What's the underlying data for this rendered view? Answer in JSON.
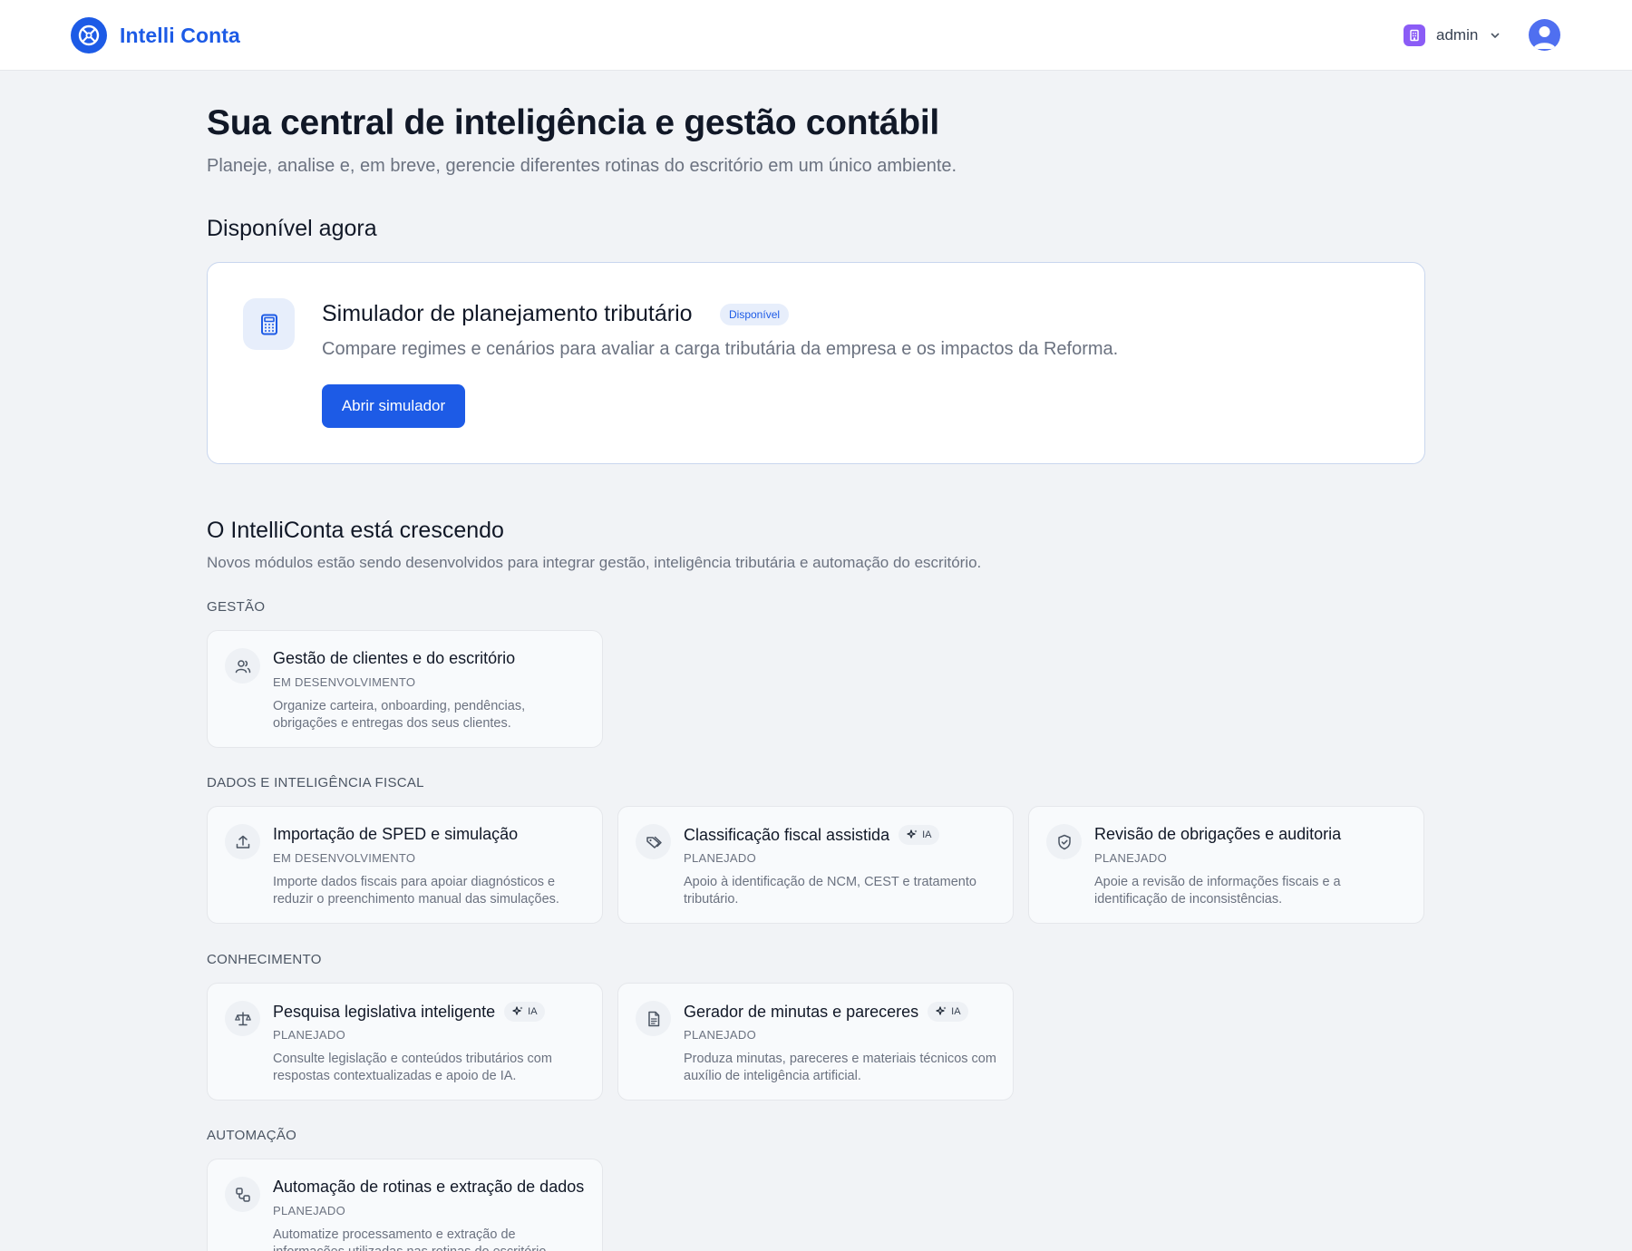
{
  "header": {
    "brand": "Intelli Conta",
    "user": "admin",
    "tenant_icon": "building-icon",
    "avatar_icon": "user-avatar-icon"
  },
  "hero": {
    "title": "Sua central de inteligência e gestão contábil",
    "subtitle": "Planeje, analise e, em breve, gerencie diferentes rotinas do escritório em um único ambiente."
  },
  "available": {
    "section_title": "Disponível agora",
    "card": {
      "icon": "calculator-icon",
      "title": "Simulador de planejamento tributário",
      "badge": "Disponível",
      "description": "Compare regimes e cenários para avaliar a carga tributária da empresa e os impactos da Reforma.",
      "button": "Abrir simulador"
    }
  },
  "growing": {
    "title": "O IntelliConta está crescendo",
    "subtitle": "Novos módulos estão sendo desenvolvidos para integrar gestão, inteligência tributária e automação do escritório."
  },
  "categories": [
    {
      "label": "GESTÃO",
      "modules": [
        {
          "icon": "users-icon",
          "title": "Gestão de clientes e do escritório",
          "status": "EM DESENVOLVIMENTO",
          "description": "Organize carteira, onboarding, pendências, obrigações e entregas dos seus clientes.",
          "ia": ""
        }
      ]
    },
    {
      "label": "DADOS E INTELIGÊNCIA FISCAL",
      "modules": [
        {
          "icon": "upload-icon",
          "title": "Importação de SPED e simulação",
          "status": "EM DESENVOLVIMENTO",
          "description": "Importe dados fiscais para apoiar diagnósticos e reduzir o preenchimento manual das simulações.",
          "ia": ""
        },
        {
          "icon": "tags-icon",
          "title": "Classificação fiscal assistida",
          "status": "PLANEJADO",
          "description": "Apoio à identificação de NCM, CEST e tratamento tributário.",
          "ia": "IA"
        },
        {
          "icon": "shield-check-icon",
          "title": "Revisão de obrigações e auditoria",
          "status": "PLANEJADO",
          "description": "Apoie a revisão de informações fiscais e a identificação de inconsistências.",
          "ia": ""
        }
      ]
    },
    {
      "label": "CONHECIMENTO",
      "modules": [
        {
          "icon": "scale-icon",
          "title": "Pesquisa legislativa inteligente",
          "status": "PLANEJADO",
          "description": "Consulte legislação e conteúdos tributários com respostas contextualizadas e apoio de IA.",
          "ia": "IA"
        },
        {
          "icon": "document-icon",
          "title": "Gerador de minutas e pareceres",
          "status": "PLANEJADO",
          "description": "Produza minutas, pareceres e materiais técnicos com auxílio de inteligência artificial.",
          "ia": "IA"
        }
      ]
    },
    {
      "label": "AUTOMAÇÃO",
      "modules": [
        {
          "icon": "workflow-icon",
          "title": "Automação de rotinas e extração de dados",
          "status": "PLANEJADO",
          "description": "Automatize processamento e extração de informações utilizadas nas rotinas do escritório.",
          "ia": ""
        }
      ]
    }
  ]
}
